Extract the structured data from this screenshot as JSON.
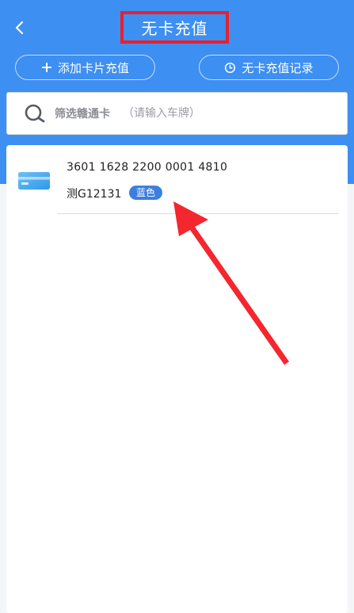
{
  "header": {
    "title": "无卡充值",
    "back_icon": "chevron-left-icon",
    "background_color": "#3d8ff2",
    "title_highlight_color": "#e8202d"
  },
  "actions": {
    "add_card_label": "添加卡片充值",
    "add_card_icon": "plus-icon",
    "records_label": "无卡充值记录",
    "records_icon": "clock-icon"
  },
  "search": {
    "label": "筛选赣通卡",
    "placeholder": "（请输入车牌）",
    "icon": "search-icon"
  },
  "cards": [
    {
      "number": "3601 1628 2200 0001 4810",
      "plate": "测G12131",
      "plate_color": "蓝色",
      "icon": "card-icon"
    }
  ],
  "annotation": {
    "arrow_color": "#f4262e"
  }
}
